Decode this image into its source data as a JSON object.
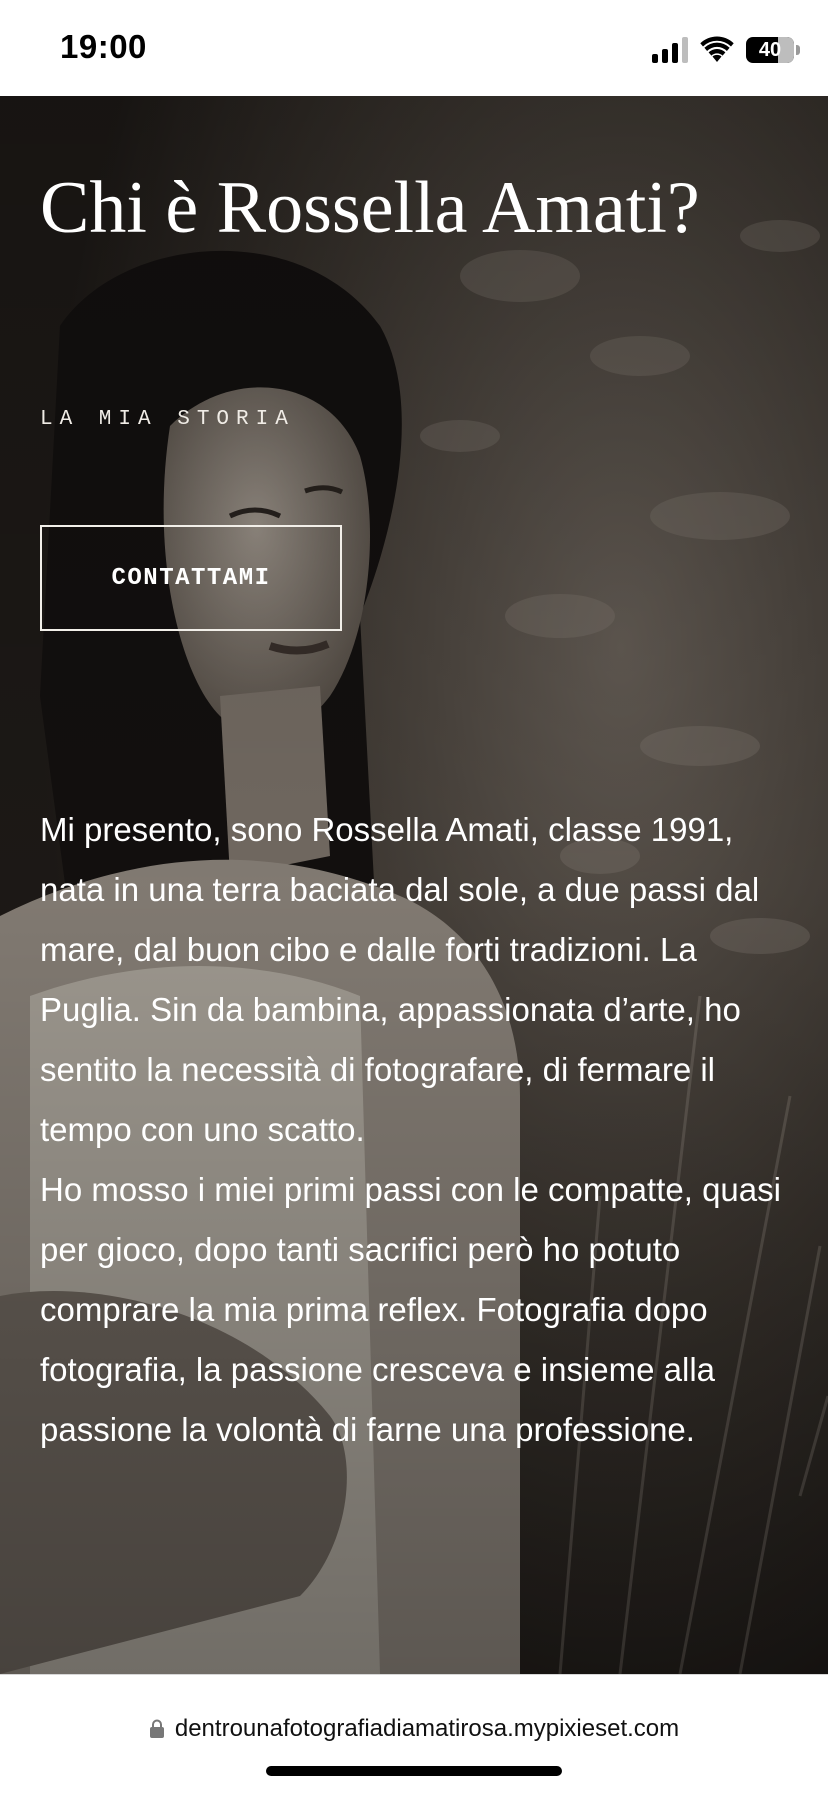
{
  "status_bar": {
    "time": "19:00",
    "battery_level": "40",
    "icons": [
      "signal-icon",
      "wifi-icon",
      "battery-icon"
    ]
  },
  "hero": {
    "title": "Chi è Rossella Amati?",
    "kicker": "LA MIA STORIA",
    "contact_button_label": "CONTATTAMI",
    "bio_paragraphs": [
      "Mi presento, sono Rossella Amati, classe 1991, nata in una terra baciata dal sole, a due passi dal mare, dal buon cibo e dalle forti tradizioni. La Puglia. Sin da bambina, appassionata d’arte, ho sentito la necessità di fotografare, di fermare il tempo con uno scatto.",
      "Ho mosso i miei primi passi con le compatte, quasi per gioco, dopo tanti sacrifici però ho potuto comprare la mia prima reflex. Fotografia dopo fotografia, la passione cresceva e insieme alla passione la volontà di farne una professione."
    ]
  },
  "browser": {
    "url": "dentrounafotografiadiamatirosa.mypixieset.com",
    "icons": [
      "lock-icon"
    ]
  },
  "colors": {
    "hero_overlay": "#2a2622",
    "text_light": "#ffffff",
    "bar_background": "#ffffff"
  }
}
